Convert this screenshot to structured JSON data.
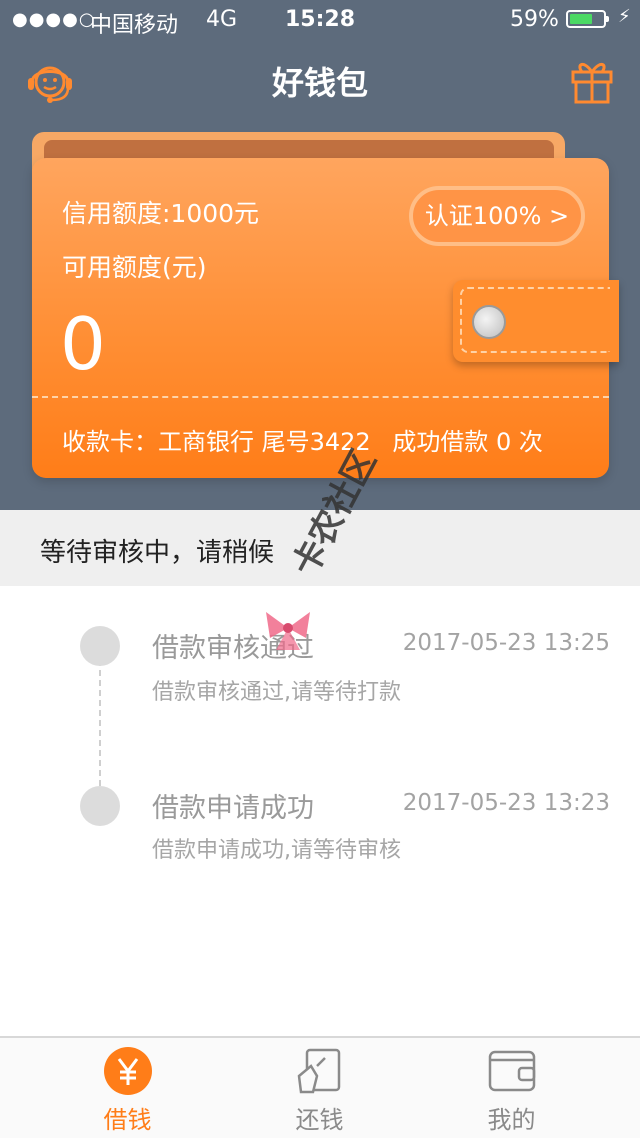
{
  "status_bar": {
    "signal": "●●●●○",
    "carrier": "中国移动",
    "network": "4G",
    "time": "15:28",
    "battery_percent": "59%",
    "battery_level": 0.59
  },
  "header": {
    "title": "好钱包",
    "left_icon": "customer-service-icon",
    "right_icon": "gift-icon"
  },
  "card": {
    "credit_limit": "信用额度:1000元",
    "available_label": "可用额度(元)",
    "available_value": "0",
    "certification": "认证100% >",
    "receiving_card": "收款卡：工商银行 尾号3422",
    "success_loans": "成功借款 0 次"
  },
  "pending": {
    "text": "等待审核中，请稍候"
  },
  "timeline": [
    {
      "title": "借款审核通过",
      "time": "2017-05-23 13:25",
      "desc": "借款审核通过,请等待打款"
    },
    {
      "title": "借款申请成功",
      "time": "2017-05-23 13:23",
      "desc": "借款申请成功,请等待审核"
    }
  ],
  "watermark": {
    "text": "卡农社区"
  },
  "tabbar": {
    "items": [
      {
        "label": "借钱",
        "icon": "yen-icon",
        "active": true
      },
      {
        "label": "还钱",
        "icon": "repay-icon",
        "active": false
      },
      {
        "label": "我的",
        "icon": "wallet-icon",
        "active": false
      }
    ]
  },
  "colors": {
    "header_bg": "#5d6b7c",
    "accent": "#ff7d18",
    "tab_active": "#ff7d18",
    "tab_inactive": "#8a8a8a"
  }
}
